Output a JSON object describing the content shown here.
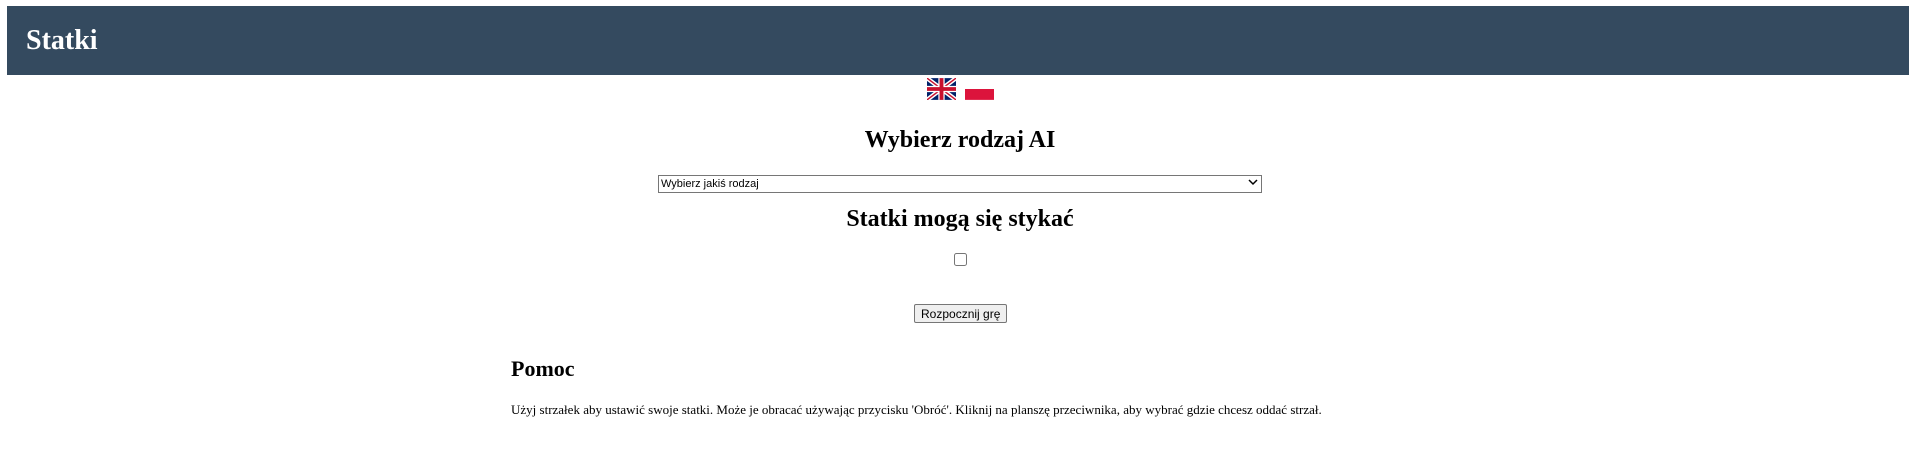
{
  "header": {
    "title": "Statki",
    "background": "#344a5f"
  },
  "language_flags": [
    {
      "name": "english",
      "icon": "uk-flag-icon"
    },
    {
      "name": "polish",
      "icon": "poland-flag-icon"
    }
  ],
  "ai_section": {
    "title": "Wybierz rodzaj AI",
    "select_value": "Wybierz jakiś rodzaj",
    "options": [
      "Wybierz jakiś rodzaj"
    ]
  },
  "touch_section": {
    "title": "Statki mogą się stykać",
    "checked": false
  },
  "start_button": {
    "label": "Rozpocznij grę"
  },
  "help": {
    "title": "Pomoc",
    "text": "Użyj strzałek aby ustawić swoje statki. Może je obracać używając przycisku 'Obróć'. Kliknij na planszę przeciwnika, aby wybrać gdzie chcesz oddać strzał."
  }
}
